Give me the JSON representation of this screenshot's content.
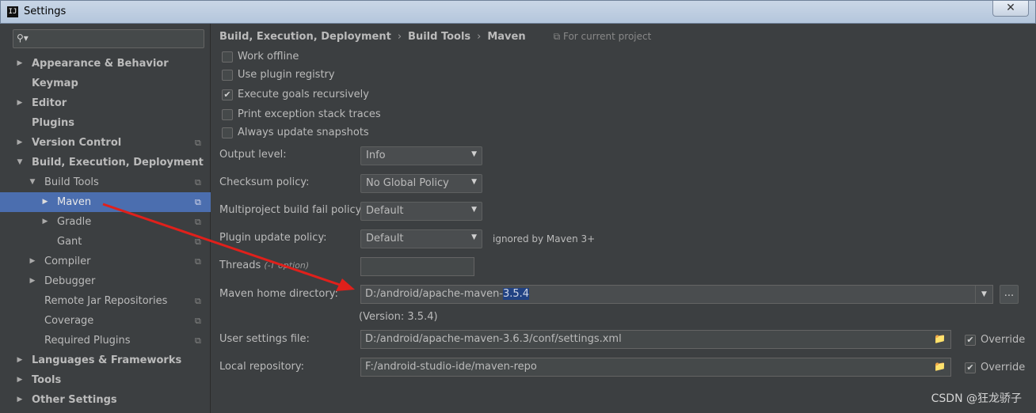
{
  "window": {
    "title": "Settings",
    "close_label": "✕"
  },
  "sidebar": {
    "search_icon": "⚲▾",
    "items": [
      {
        "label": "Appearance & Behavior",
        "bold": true,
        "arrow": "▶"
      },
      {
        "label": "Keymap",
        "bold": true,
        "arrow": ""
      },
      {
        "label": "Editor",
        "bold": true,
        "arrow": "▶"
      },
      {
        "label": "Plugins",
        "bold": true,
        "arrow": ""
      },
      {
        "label": "Version Control",
        "bold": true,
        "arrow": "▶"
      },
      {
        "label": "Build, Execution, Deployment",
        "bold": true,
        "arrow": "▼"
      },
      {
        "label": "Build Tools",
        "bold": false,
        "arrow": "▼"
      },
      {
        "label": "Maven",
        "bold": false,
        "arrow": "▶"
      },
      {
        "label": "Gradle",
        "bold": false,
        "arrow": "▶"
      },
      {
        "label": "Gant",
        "bold": false,
        "arrow": ""
      },
      {
        "label": "Compiler",
        "bold": false,
        "arrow": "▶"
      },
      {
        "label": "Debugger",
        "bold": false,
        "arrow": "▶"
      },
      {
        "label": "Remote Jar Repositories",
        "bold": false,
        "arrow": ""
      },
      {
        "label": "Coverage",
        "bold": false,
        "arrow": ""
      },
      {
        "label": "Required Plugins",
        "bold": false,
        "arrow": ""
      },
      {
        "label": "Languages & Frameworks",
        "bold": true,
        "arrow": "▶"
      },
      {
        "label": "Tools",
        "bold": true,
        "arrow": "▶"
      },
      {
        "label": "Other Settings",
        "bold": true,
        "arrow": "▶"
      }
    ],
    "project_icon": "⧉"
  },
  "breadcrumb": {
    "part1": "Build, Execution, Deployment",
    "part2": "Build Tools",
    "part3": "Maven",
    "separator": "›",
    "scope": "⧉ For current project"
  },
  "checkboxes": [
    {
      "label": "Work offline",
      "checked": false
    },
    {
      "label": "Use plugin registry",
      "checked": false
    },
    {
      "label": "Execute goals recursively",
      "checked": true
    },
    {
      "label": "Print exception stack traces",
      "checked": false
    },
    {
      "label": "Always update snapshots",
      "checked": false
    }
  ],
  "check_mark": "✔",
  "form": {
    "output_level_label": "Output level:",
    "output_level_value": "Info",
    "checksum_label": "Checksum policy:",
    "checksum_value": "No Global Policy",
    "fail_policy_label": "Multiproject build fail policy:",
    "fail_policy_value": "Default",
    "plugin_update_label": "Plugin update policy:",
    "plugin_update_value": "Default",
    "plugin_update_note": "ignored by Maven 3+",
    "threads_label": "Threads",
    "threads_hint": "(-T option)",
    "threads_value": "",
    "maven_home_label": "Maven home directory:",
    "maven_home_prefix": "D:/android/apache-maven-",
    "maven_home_selected": "3.5.4",
    "maven_version": "(Version: 3.5.4)",
    "browse_label": "...",
    "user_settings_label": "User settings file:",
    "user_settings_value": "D:/android/apache-maven-3.6.3/conf/settings.xml",
    "local_repo_label": "Local repository:",
    "local_repo_value": "F:/android-studio-ide/maven-repo",
    "override_label": "Override",
    "dropdown_icon": "▼",
    "folder_icon": "📁"
  },
  "watermark": "CSDN @狂龙骄子",
  "accent_color": "#4b6eaf",
  "annotation_color": "#e0201b"
}
